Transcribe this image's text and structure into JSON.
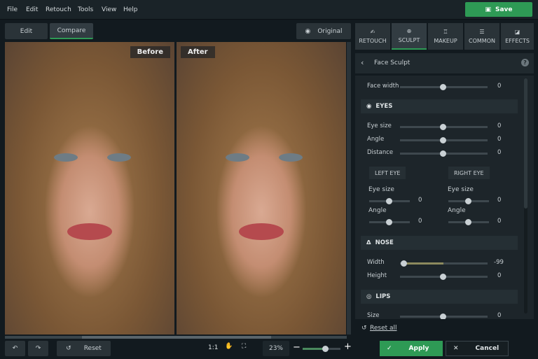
{
  "menu": [
    "File",
    "Edit",
    "Retouch",
    "Tools",
    "View",
    "Help"
  ],
  "save_label": "Save",
  "toolbar": {
    "edit": "Edit",
    "compare": "Compare",
    "original": "Original"
  },
  "photos": {
    "before": "Before",
    "after": "After"
  },
  "bottom": {
    "reset": "Reset",
    "one_to_one": "1:1",
    "zoom": "23%",
    "zoom_level": 0.6
  },
  "tabs": [
    {
      "label": "RETOUCH",
      "icon": "retouch-icon"
    },
    {
      "label": "SCULPT",
      "icon": "sculpt-icon",
      "active": true
    },
    {
      "label": "MAKEUP",
      "icon": "makeup-icon"
    },
    {
      "label": "COMMON",
      "icon": "sliders-icon"
    },
    {
      "label": "EFFECTS",
      "icon": "effects-icon"
    }
  ],
  "panel": {
    "title": "Face Sculpt",
    "face_width": {
      "label": "Face width",
      "value": "0"
    },
    "eyes": {
      "title": "EYES",
      "size": {
        "label": "Eye size",
        "value": "0"
      },
      "angle": {
        "label": "Angle",
        "value": "0"
      },
      "distance": {
        "label": "Distance",
        "value": "0"
      },
      "left_eye": "LEFT EYE",
      "right_eye": "RIGHT EYE",
      "left": {
        "size": {
          "label": "Eye size",
          "value": "0"
        },
        "angle": {
          "label": "Angle",
          "value": "0"
        }
      },
      "right": {
        "size": {
          "label": "Eye size",
          "value": "0"
        },
        "angle": {
          "label": "Angle",
          "value": "0"
        }
      }
    },
    "nose": {
      "title": "NOSE",
      "width": {
        "label": "Width",
        "value": "-99"
      },
      "height": {
        "label": "Height",
        "value": "0"
      }
    },
    "lips": {
      "title": "LIPS",
      "size": {
        "label": "Size",
        "value": "0"
      }
    },
    "reset_all": "Reset all",
    "apply": "Apply",
    "cancel": "Cancel"
  },
  "colors": {
    "accent": "#2e9a55",
    "bg": "#121a1f"
  }
}
